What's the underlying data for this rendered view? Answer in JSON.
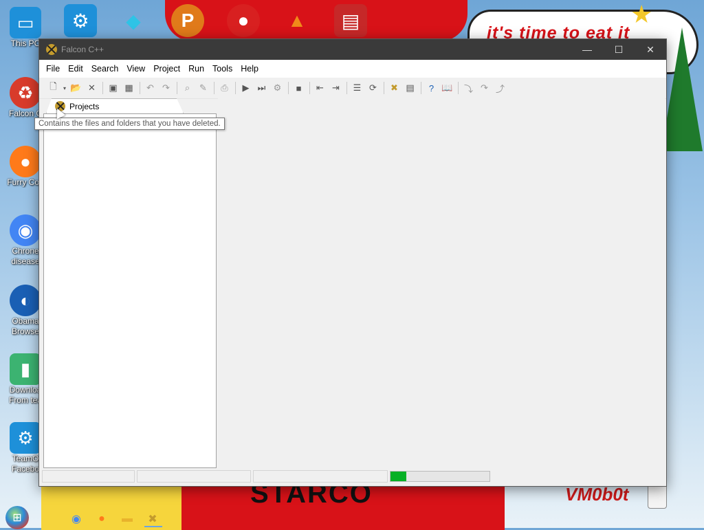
{
  "desktop": {
    "wallpaper_text": {
      "bubble": "it's time to eat it",
      "sign": "STARCO",
      "signature": "VM0b0t"
    },
    "left_icons": [
      {
        "name": "this-pc",
        "label": "This PC",
        "icon": "monitor-icon",
        "color": "#1e90d9"
      },
      {
        "name": "falcon",
        "label": "Falcon C",
        "icon": "recycle-bin-icon",
        "color": "#d83b2b"
      },
      {
        "name": "furry-cool",
        "label": "Furry Coo",
        "icon": "firefox-icon",
        "color": "#ff7a1a"
      },
      {
        "name": "chrone",
        "label": "Chrone disease",
        "icon": "chrome-icon",
        "color": "#4285f4"
      },
      {
        "name": "obama",
        "label": "Obama Browse",
        "icon": "obama-logo-icon",
        "color": "#1a5fb4"
      },
      {
        "name": "download",
        "label": "Downloa From tea",
        "icon": "download-icon",
        "color": "#3cb371"
      },
      {
        "name": "teamo",
        "label": "TeamO Facebo",
        "icon": "gear-icon",
        "color": "#1e90d9"
      }
    ],
    "top_icons": [
      {
        "name": "settings",
        "icon": "gear-icon",
        "color": "#1e90d9"
      },
      {
        "name": "diamond",
        "icon": "diamond-icon",
        "color": "#2ec3e6"
      },
      {
        "name": "p-app",
        "icon": "p-logo-icon",
        "color": "#e07a1a"
      },
      {
        "name": "angry-birds",
        "icon": "bird-icon",
        "color": "#d82020"
      },
      {
        "name": "vlc",
        "icon": "cone-icon",
        "color": "#f08a1a"
      },
      {
        "name": "red-app",
        "icon": "document-icon",
        "color": "#c62828"
      }
    ]
  },
  "window": {
    "title": "Falcon C++",
    "controls": {
      "minimize": "—",
      "maximize": "☐",
      "close": "✕"
    },
    "menu": [
      "File",
      "Edit",
      "Search",
      "View",
      "Project",
      "Run",
      "Tools",
      "Help"
    ],
    "toolbar_icons": [
      "new-file-icon",
      "dropdown-arrow-icon",
      "open-folder-icon",
      "close-icon",
      "sep",
      "save-icon",
      "save-all-icon",
      "sep",
      "undo-icon",
      "redo-icon",
      "sep",
      "find-icon",
      "replace-icon",
      "sep",
      "print-icon",
      "sep",
      "run-icon",
      "step-icon",
      "build-icon",
      "sep",
      "stop-icon",
      "sep",
      "back-icon",
      "forward-icon",
      "sep",
      "list-icon",
      "refresh-icon",
      "sep",
      "falcon-icon",
      "properties-icon",
      "sep",
      "help-icon",
      "book-icon",
      "sep",
      "step-into-icon",
      "step-over-icon",
      "step-out-icon"
    ],
    "projects_tab": {
      "label": "Projects",
      "icon": "falcon-icon"
    },
    "tooltip": "Contains the files and folders that you have deleted.",
    "status": {
      "progress": 0.16,
      "progress_color": "#06b025"
    }
  },
  "taskbar": {
    "start_icon": "windows-logo-icon",
    "pinned": [
      {
        "name": "chrome",
        "icon": "chrome-icon",
        "color": "#4285f4"
      },
      {
        "name": "firefox",
        "icon": "firefox-icon",
        "color": "#ff7a1a"
      },
      {
        "name": "explorer",
        "icon": "folder-icon",
        "color": "#e8b22c"
      },
      {
        "name": "falcon",
        "icon": "falcon-icon",
        "color": "#c39b2d"
      }
    ]
  }
}
